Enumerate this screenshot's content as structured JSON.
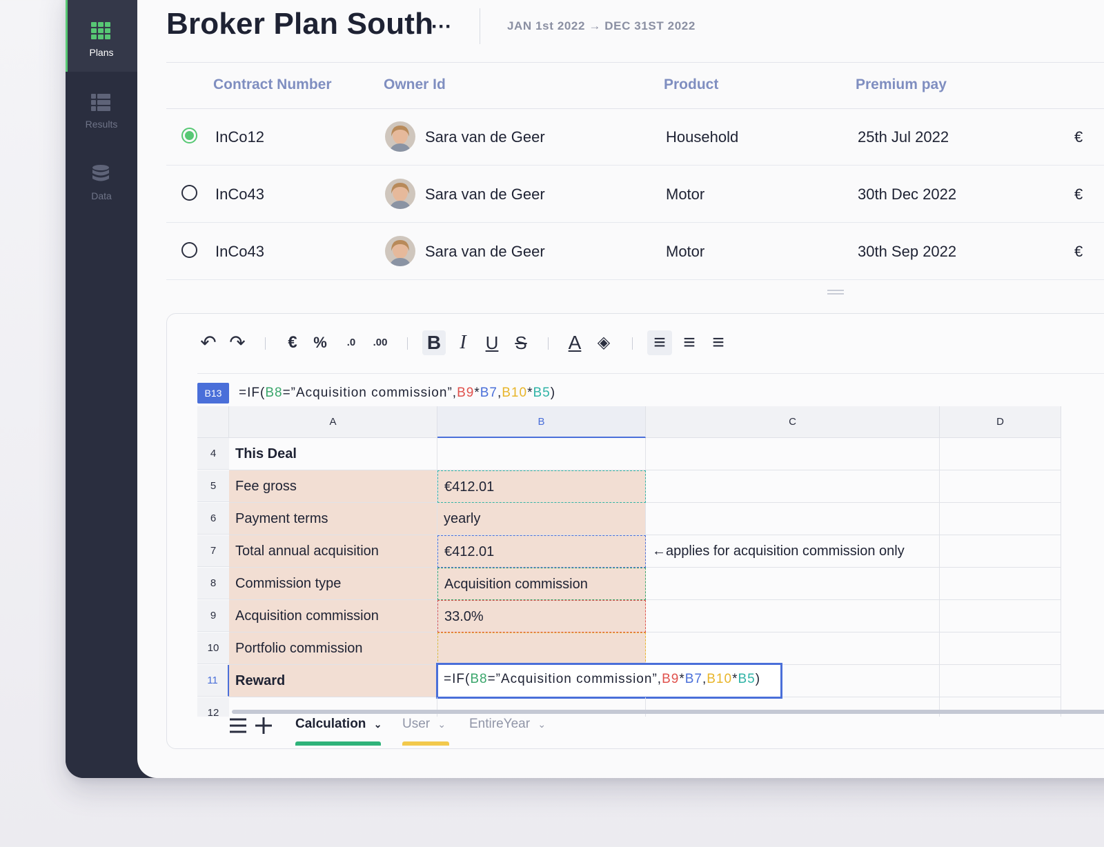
{
  "sidebar": {
    "items": [
      {
        "label": "Plans",
        "icon": "grid-icon",
        "active": true
      },
      {
        "label": "Results",
        "icon": "list-icon",
        "active": false
      },
      {
        "label": "Data",
        "icon": "database-icon",
        "active": false
      }
    ]
  },
  "header": {
    "title": "Broker Plan South",
    "more": "···",
    "date_range": "JAN 1st 2022 → DEC 31ST 2022"
  },
  "contracts": {
    "columns": [
      "Contract Number",
      "Owner Id",
      "Product",
      "Premium pay"
    ],
    "rows": [
      {
        "contract": "InCo12",
        "owner": "Sara van de Geer",
        "product": "Household",
        "premium": "25th Jul 2022",
        "extra": "€",
        "selected": true
      },
      {
        "contract": "InCo43",
        "owner": "Sara van de Geer",
        "product": "Motor",
        "premium": "30th Dec 2022",
        "extra": "€",
        "selected": false
      },
      {
        "contract": "InCo43",
        "owner": "Sara van de Geer",
        "product": "Motor",
        "premium": "30th Sep 2022",
        "extra": "€",
        "selected": false
      }
    ]
  },
  "toolbar": {
    "undo": "↶",
    "redo": "↷",
    "currency": "€",
    "percent": "%",
    "dec_decrease": ".0",
    "dec_increase": ".00",
    "bold": "B",
    "italic": "I",
    "underline": "U",
    "strike": "S",
    "text_color": "A",
    "fill": "◈",
    "align_left": "≡",
    "align_center": "≡",
    "align_right": "≡"
  },
  "spreadsheet": {
    "cell_ref": "B13",
    "formula_parts": [
      "=IF(",
      "B8",
      "=”Acquisition commission”,",
      "B9",
      "*",
      "B7",
      ",",
      "B10",
      "*",
      "B5",
      ")"
    ],
    "columns": [
      "A",
      "B",
      "C",
      "D"
    ],
    "rows": [
      {
        "num": "4",
        "a": "This Deal",
        "b": "",
        "c": ""
      },
      {
        "num": "5",
        "a": "Fee gross",
        "b": "€412.01",
        "c": ""
      },
      {
        "num": "6",
        "a": "Payment terms",
        "b": "yearly",
        "c": ""
      },
      {
        "num": "7",
        "a": "Total annual acquisition",
        "b": "€412.01",
        "c": "←applies for acquisition commission only"
      },
      {
        "num": "8",
        "a": "Commission type",
        "b": "Acquisition commission",
        "c": ""
      },
      {
        "num": "9",
        "a": "Acquisition commission",
        "b": "33.0%",
        "c": ""
      },
      {
        "num": "10",
        "a": "Portfolio commission",
        "b": "",
        "c": ""
      },
      {
        "num": "11",
        "a": "Reward",
        "b": "",
        "c": ""
      },
      {
        "num": "12",
        "a": "",
        "b": "",
        "c": ""
      }
    ],
    "tabs": [
      {
        "label": "Calculation",
        "active": true,
        "color": "#2fb37a"
      },
      {
        "label": "User",
        "active": false,
        "color": "#f2c94c"
      },
      {
        "label": "EntireYear",
        "active": false,
        "color": ""
      }
    ]
  }
}
